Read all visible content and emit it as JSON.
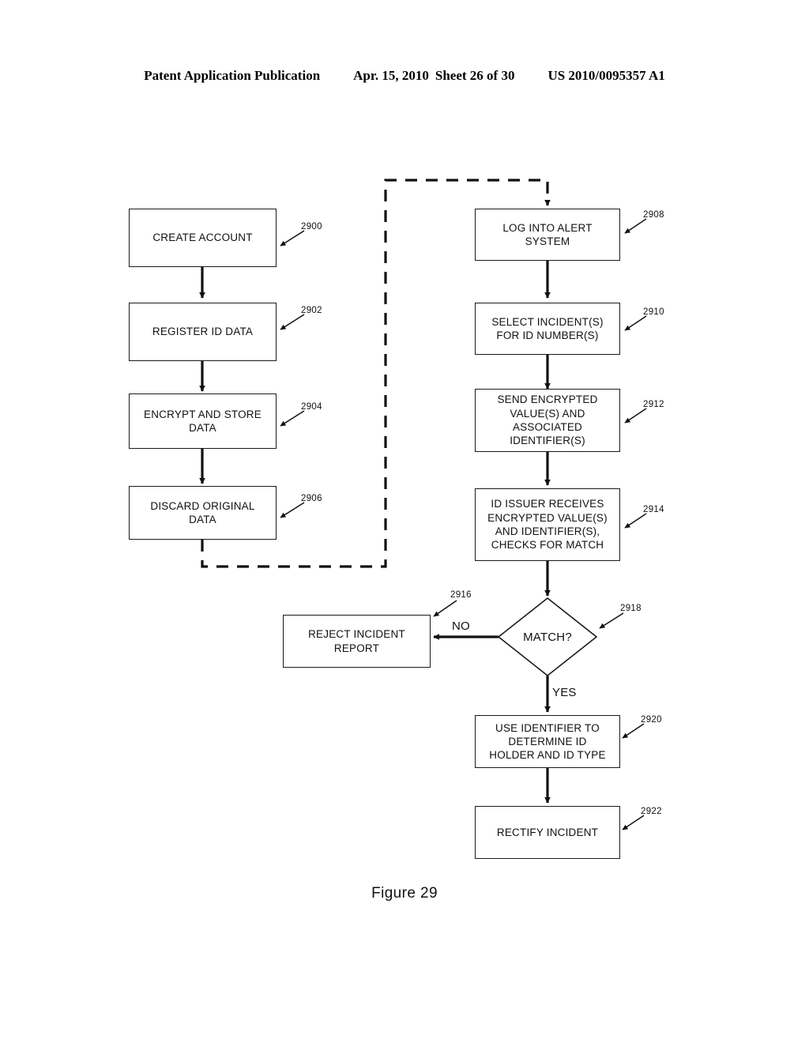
{
  "header": {
    "publication": "Patent Application Publication",
    "date": "Apr. 15, 2010",
    "sheet": "Sheet 26 of 30",
    "patent_number": "US 2010/0095357 A1"
  },
  "caption": "Figure 29",
  "diagram": {
    "type": "flowchart",
    "branch_labels": {
      "no": "NO",
      "yes": "YES"
    },
    "nodes": [
      {
        "id": "2900",
        "ref": "2900",
        "shape": "process",
        "text": "CREATE ACCOUNT"
      },
      {
        "id": "2902",
        "ref": "2902",
        "shape": "process",
        "text": "REGISTER ID DATA"
      },
      {
        "id": "2904",
        "ref": "2904",
        "shape": "process",
        "text": "ENCRYPT AND STORE\nDATA"
      },
      {
        "id": "2906",
        "ref": "2906",
        "shape": "process",
        "text": "DISCARD ORIGINAL\nDATA"
      },
      {
        "id": "2908",
        "ref": "2908",
        "shape": "process",
        "text": "LOG INTO ALERT\nSYSTEM"
      },
      {
        "id": "2910",
        "ref": "2910",
        "shape": "process",
        "text": "SELECT INCIDENT(S)\nFOR ID NUMBER(S)"
      },
      {
        "id": "2912",
        "ref": "2912",
        "shape": "process",
        "text": "SEND ENCRYPTED\nVALUE(S) AND\nASSOCIATED\nIDENTIFIER(S)"
      },
      {
        "id": "2914",
        "ref": "2914",
        "shape": "process",
        "text": "ID ISSUER RECEIVES\nENCRYPTED VALUE(S)\nAND IDENTIFIER(S),\nCHECKS FOR MATCH"
      },
      {
        "id": "2916",
        "ref": "2916",
        "shape": "process",
        "text": "REJECT INCIDENT\nREPORT"
      },
      {
        "id": "2918",
        "ref": "2918",
        "shape": "decision",
        "text": "MATCH?"
      },
      {
        "id": "2920",
        "ref": "2920",
        "shape": "process",
        "text": "USE IDENTIFIER TO\nDETERMINE ID\nHOLDER AND ID TYPE"
      },
      {
        "id": "2922",
        "ref": "2922",
        "shape": "process",
        "text": "RECTIFY INCIDENT"
      }
    ],
    "edges": [
      {
        "from": "2900",
        "to": "2902",
        "style": "solid"
      },
      {
        "from": "2902",
        "to": "2904",
        "style": "solid"
      },
      {
        "from": "2904",
        "to": "2906",
        "style": "solid"
      },
      {
        "from": "2906",
        "to": "2908",
        "style": "dashed"
      },
      {
        "from": "2908",
        "to": "2910",
        "style": "solid"
      },
      {
        "from": "2910",
        "to": "2912",
        "style": "solid"
      },
      {
        "from": "2912",
        "to": "2914",
        "style": "solid"
      },
      {
        "from": "2914",
        "to": "2918",
        "style": "solid"
      },
      {
        "from": "2918",
        "to": "2916",
        "style": "solid",
        "label": "NO"
      },
      {
        "from": "2918",
        "to": "2920",
        "style": "solid",
        "label": "YES"
      },
      {
        "from": "2920",
        "to": "2922",
        "style": "solid"
      }
    ]
  }
}
